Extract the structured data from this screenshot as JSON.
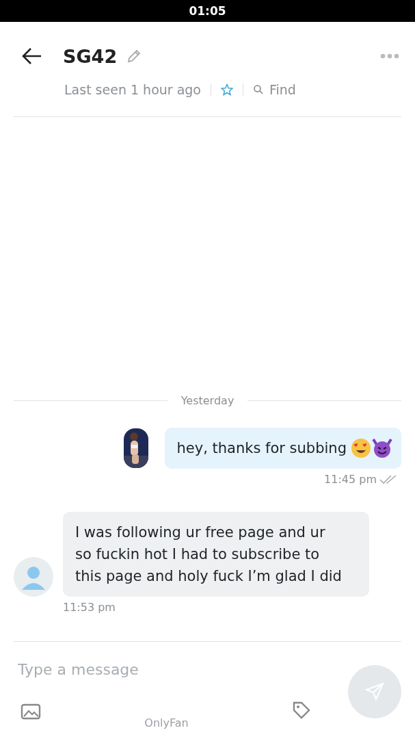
{
  "status_bar": {
    "time": "01:05"
  },
  "header": {
    "title": "SG42",
    "last_seen": "Last seen 1 hour ago",
    "starred": false,
    "find": "Find"
  },
  "day_separator": "Yesterday",
  "messages": [
    {
      "kind": "outgoing",
      "text": "hey, thanks for subbing",
      "time": "11:45 pm",
      "read": true
    },
    {
      "kind": "incoming",
      "text": "I was following ur free page and ur so fuckin hot I had to subscribe to this page and holy fuck I’m glad I did",
      "time": "11:53 pm"
    }
  ],
  "composer": {
    "placeholder": "Type a message"
  },
  "footer": "OnlyFan"
}
